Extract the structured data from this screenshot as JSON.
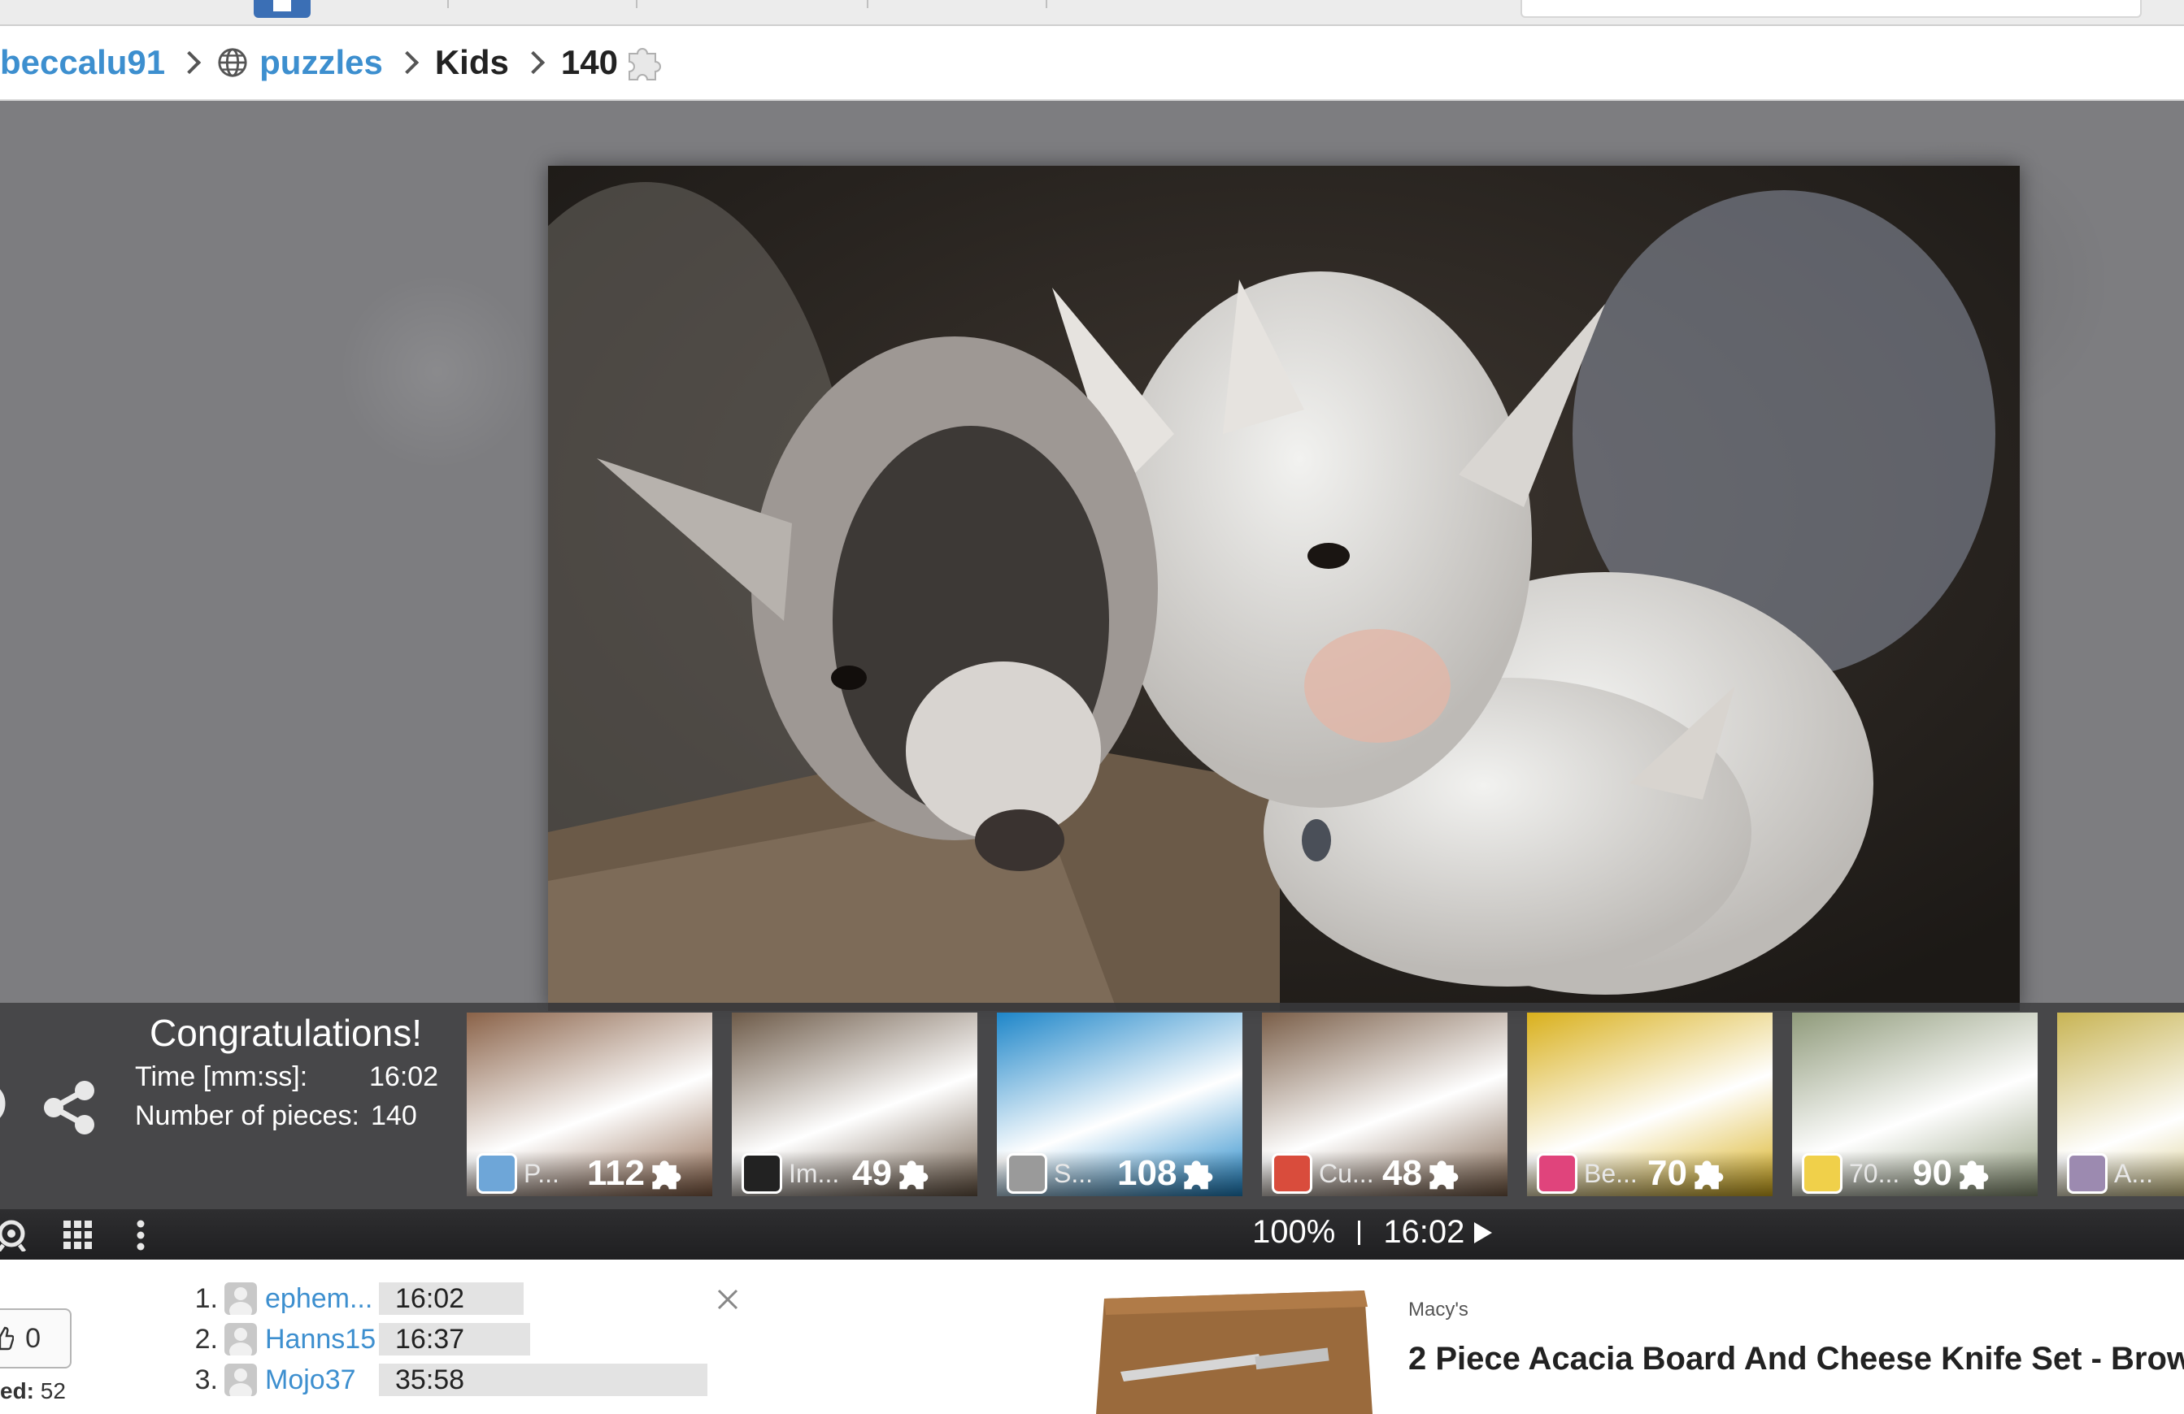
{
  "breadcrumb": {
    "user": "beccalu91",
    "section": "puzzles",
    "category": "Kids",
    "pieces": "140"
  },
  "congrats": {
    "title": "Congratulations!",
    "time_label": "Time [mm:ss]:",
    "time_value": "16:02",
    "pieces_label": "Number of pieces:",
    "pieces_value": "140"
  },
  "suggestions": [
    {
      "name": "P...",
      "count": "112",
      "thumb_color": "#8a6248",
      "avatar_color": "#6ea6d8"
    },
    {
      "name": "Im...",
      "count": "49",
      "thumb_color": "#6d5a48",
      "avatar_color": "#222222"
    },
    {
      "name": "S...",
      "count": "108",
      "thumb_color": "#1e86c9",
      "avatar_color": "#9a9a9a"
    },
    {
      "name": "Cu...",
      "count": "48",
      "thumb_color": "#7a5e48",
      "avatar_color": "#d94c3c"
    },
    {
      "name": "Be...",
      "count": "70",
      "thumb_color": "#d9b01c",
      "avatar_color": "#e0447c"
    },
    {
      "name": "70...",
      "count": "90",
      "thumb_color": "#8f9a7a",
      "avatar_color": "#f0d04a"
    },
    {
      "name": "A...",
      "count": "",
      "thumb_color": "#c8b454",
      "avatar_color": "#9c8ab0"
    }
  ],
  "controls": {
    "zoom": "100%",
    "timer": "16:02"
  },
  "leaderboard": [
    {
      "rank": "1.",
      "name": "ephem...",
      "time": "16:02"
    },
    {
      "rank": "2.",
      "name": "Hanns15",
      "time": "16:37"
    },
    {
      "rank": "3.",
      "name": "Mojo37",
      "time": "35:58"
    }
  ],
  "likes": {
    "count": "0",
    "solved_label": "ed:",
    "solved_value": "52"
  },
  "ad": {
    "brand": "Macy's",
    "title": "2 Piece Acacia Board And Cheese Knife Set - Brow"
  },
  "colors": {
    "link": "#3d8fcf",
    "congrats_bg": "#37373a",
    "control_bg": "#232325"
  }
}
